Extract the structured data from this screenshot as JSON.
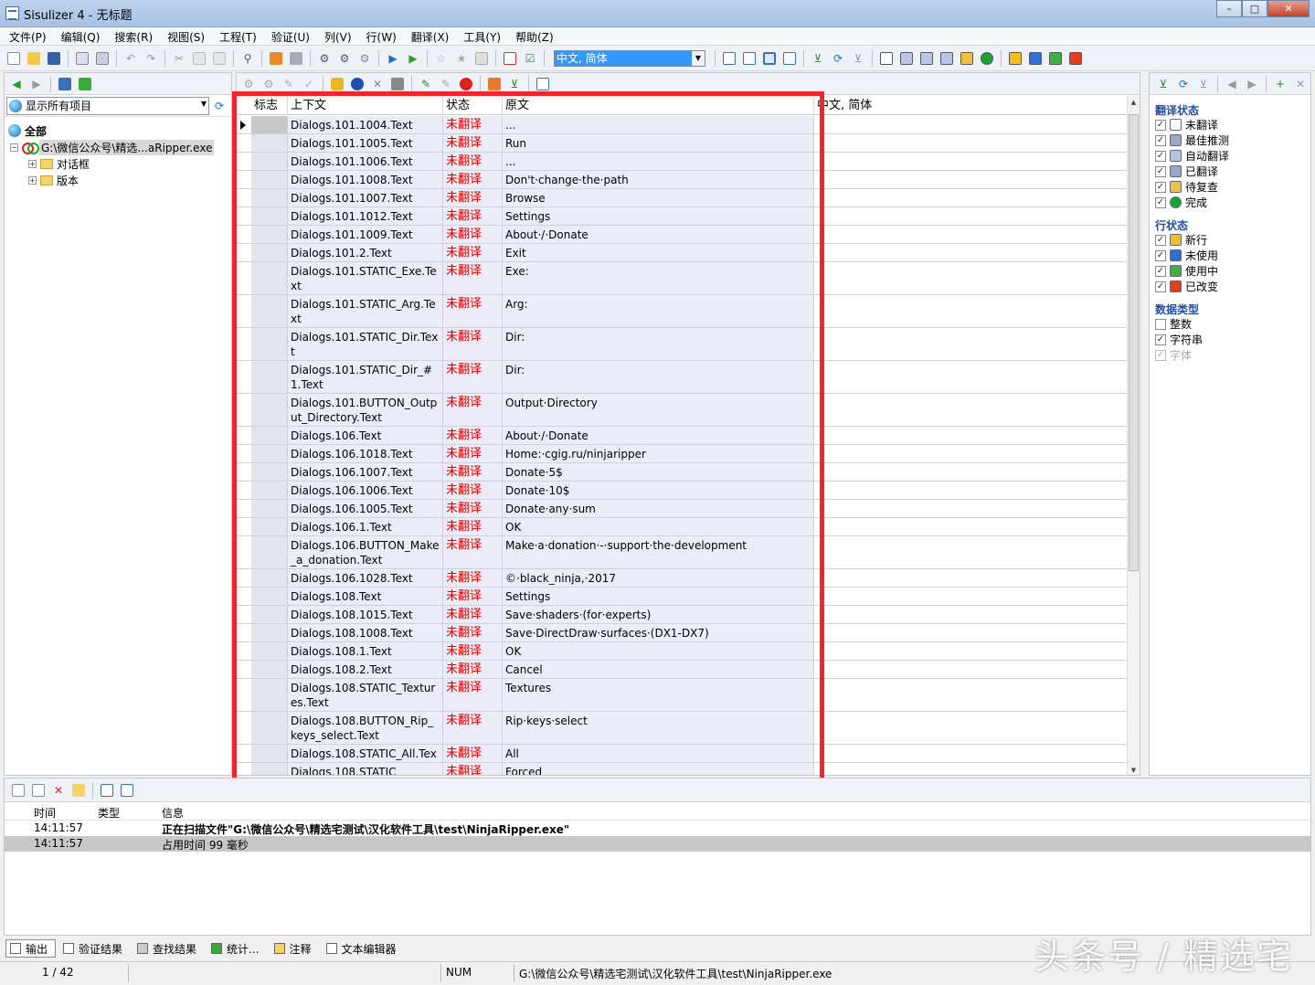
{
  "window": {
    "title": "Sisulizer 4 - 无标题"
  },
  "menu": [
    "文件(P)",
    "编辑(Q)",
    "搜索(R)",
    "视图(S)",
    "工程(T)",
    "验证(U)",
    "列(V)",
    "行(W)",
    "翻译(X)",
    "工具(Y)",
    "帮助(Z)"
  ],
  "toolbar": {
    "language": "中文, 简体"
  },
  "left": {
    "filter": "显示所有项目",
    "tree": {
      "root": "全部",
      "project": "G:\\微信公众号\\精选...aRipper.exe",
      "children": [
        "对话框",
        "版本"
      ]
    }
  },
  "grid": {
    "headers": {
      "flag": "标志",
      "context": "上下文",
      "status": "状态",
      "source": "原文",
      "translation": "中文, 简体"
    },
    "rows": [
      {
        "context": "Dialogs.101.1004.Text",
        "status": "未翻译",
        "source": "...",
        "lines": 1
      },
      {
        "context": "Dialogs.101.1005.Text",
        "status": "未翻译",
        "source": "Run",
        "lines": 1
      },
      {
        "context": "Dialogs.101.1006.Text",
        "status": "未翻译",
        "source": "...",
        "lines": 1
      },
      {
        "context": "Dialogs.101.1008.Text",
        "status": "未翻译",
        "source": "Don't·change·the·path",
        "lines": 1
      },
      {
        "context": "Dialogs.101.1007.Text",
        "status": "未翻译",
        "source": "Browse",
        "lines": 1
      },
      {
        "context": "Dialogs.101.1012.Text",
        "status": "未翻译",
        "source": "Settings",
        "lines": 1
      },
      {
        "context": "Dialogs.101.1009.Text",
        "status": "未翻译",
        "source": "About·/·Donate",
        "lines": 1
      },
      {
        "context": "Dialogs.101.2.Text",
        "status": "未翻译",
        "source": "Exit",
        "lines": 1
      },
      {
        "context": "Dialogs.101.STATIC_Exe.Text",
        "status": "未翻译",
        "source": "Exe:",
        "lines": 2
      },
      {
        "context": "Dialogs.101.STATIC_Arg.Text",
        "status": "未翻译",
        "source": "Arg:",
        "lines": 2
      },
      {
        "context": "Dialogs.101.STATIC_Dir.Text",
        "status": "未翻译",
        "source": "Dir:",
        "lines": 2
      },
      {
        "context": "Dialogs.101.STATIC_Dir_#1.Text",
        "status": "未翻译",
        "source": "Dir:",
        "lines": 2
      },
      {
        "context": "Dialogs.101.BUTTON_Output_Directory.Text",
        "status": "未翻译",
        "source": "Output·Directory",
        "lines": 2
      },
      {
        "context": "Dialogs.106.Text",
        "status": "未翻译",
        "source": "About·/·Donate",
        "lines": 1
      },
      {
        "context": "Dialogs.106.1018.Text",
        "status": "未翻译",
        "source": "Home:·cgig.ru/ninjaripper",
        "lines": 1
      },
      {
        "context": "Dialogs.106.1007.Text",
        "status": "未翻译",
        "source": "Donate·5$",
        "lines": 1
      },
      {
        "context": "Dialogs.106.1006.Text",
        "status": "未翻译",
        "source": "Donate·10$",
        "lines": 1
      },
      {
        "context": "Dialogs.106.1005.Text",
        "status": "未翻译",
        "source": "Donate·any·sum",
        "lines": 1
      },
      {
        "context": "Dialogs.106.1.Text",
        "status": "未翻译",
        "source": "OK",
        "lines": 1
      },
      {
        "context": "Dialogs.106.BUTTON_Make_a_donation.Text",
        "status": "未翻译",
        "source": "Make·a·donation·-·support·the·development",
        "lines": 2
      },
      {
        "context": "Dialogs.106.1028.Text",
        "status": "未翻译",
        "source": "©·black_ninja,·2017",
        "lines": 1
      },
      {
        "context": "Dialogs.108.Text",
        "status": "未翻译",
        "source": "Settings",
        "lines": 1
      },
      {
        "context": "Dialogs.108.1015.Text",
        "status": "未翻译",
        "source": "Save·shaders·(for·experts)",
        "lines": 1
      },
      {
        "context": "Dialogs.108.1008.Text",
        "status": "未翻译",
        "source": "Save·DirectDraw·surfaces·(DX1-DX7)",
        "lines": 1
      },
      {
        "context": "Dialogs.108.1.Text",
        "status": "未翻译",
        "source": "OK",
        "lines": 1
      },
      {
        "context": "Dialogs.108.2.Text",
        "status": "未翻译",
        "source": "Cancel",
        "lines": 1
      },
      {
        "context": "Dialogs.108.STATIC_Textures.Text",
        "status": "未翻译",
        "source": "Textures",
        "lines": 2
      },
      {
        "context": "Dialogs.108.BUTTON_Rip_keys_select.Text",
        "status": "未翻译",
        "source": "Rip·keys·select",
        "lines": 2
      },
      {
        "context": "Dialogs.108.STATIC_All.Text",
        "status": "未翻译",
        "source": "All",
        "lines": 1
      },
      {
        "context": "Dialogs.108.STATIC_",
        "status": "未翻译",
        "source": "Forced",
        "lines": 1
      }
    ]
  },
  "right": {
    "sections": [
      {
        "title": "翻译状态",
        "items": [
          {
            "label": "未翻译",
            "checked": true,
            "icon": "page-icon",
            "color": "#ffffff"
          },
          {
            "label": "最佳推测",
            "checked": true,
            "icon": "guess-icon",
            "color": "#9aa6c8"
          },
          {
            "label": "自动翻译",
            "checked": true,
            "icon": "auto-translate-icon",
            "color": "#b8c4e0"
          },
          {
            "label": "已翻译",
            "checked": true,
            "icon": "translated-icon",
            "color": "#9aa6c8"
          },
          {
            "label": "待复查",
            "checked": true,
            "icon": "review-icon",
            "color": "#f0c040"
          },
          {
            "label": "完成",
            "checked": true,
            "icon": "complete-icon",
            "color": "#20a030"
          }
        ]
      },
      {
        "title": "行状态",
        "items": [
          {
            "label": "新行",
            "checked": true,
            "icon": "new-row-icon",
            "color": "#f0c020"
          },
          {
            "label": "未使用",
            "checked": true,
            "icon": "unused-icon",
            "color": "#3070d0"
          },
          {
            "label": "使用中",
            "checked": true,
            "icon": "in-use-icon",
            "color": "#40b040"
          },
          {
            "label": "已改变",
            "checked": true,
            "icon": "changed-icon",
            "color": "#e04020"
          }
        ]
      },
      {
        "title": "数据类型",
        "items": [
          {
            "label": "整数",
            "checked": false
          },
          {
            "label": "字符串",
            "checked": true
          },
          {
            "label": "字体",
            "checked": true,
            "disabled": true
          }
        ]
      }
    ]
  },
  "output": {
    "headers": {
      "time": "时间",
      "type": "类型",
      "info": "信息"
    },
    "rows": [
      {
        "time": "14:11:57",
        "info": "正在扫描文件\"G:\\微信公众号\\精选宅测试\\汉化软件工具\\test\\NinjaRipper.exe\"",
        "bold": true
      },
      {
        "time": "14:11:57",
        "info": "占用时间 99 毫秒",
        "bold": false,
        "alt": true
      }
    ]
  },
  "tabs": [
    "输出",
    "验证结果",
    "查找结果",
    "统计...",
    "注释",
    "文本编辑器"
  ],
  "status": {
    "position": "1 / 42",
    "num": "NUM",
    "path": "G:\\微信公众号\\精选宅测试\\汉化软件工具\\test\\NinjaRipper.exe"
  },
  "watermark": "头条号 / 精选宅"
}
